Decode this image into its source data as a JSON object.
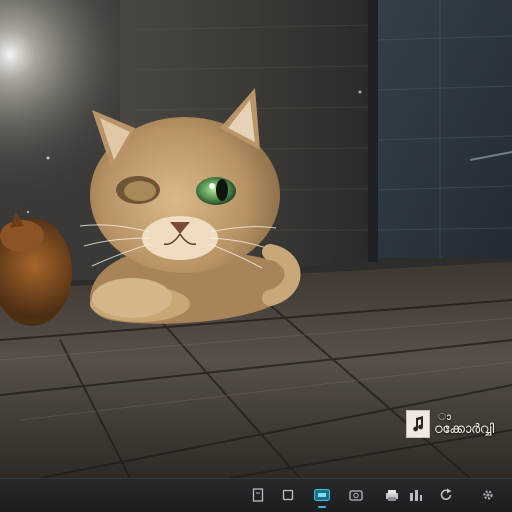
{
  "desktop": {
    "wallpaper": "cat-scene-wallpaper",
    "accent_color": "#34b7d6"
  },
  "notification": {
    "icon": "music-note-icon",
    "line1": "ാ",
    "line2": "ഠക്കോർവ്വി"
  },
  "taskbar": {
    "items": [
      {
        "icon": "document-icon"
      },
      {
        "icon": "window-icon"
      },
      {
        "icon": "app-icon-active",
        "active": true
      },
      {
        "icon": "camera-icon"
      },
      {
        "icon": "printer-icon"
      },
      {
        "icon": "bars-icon"
      },
      {
        "icon": "refresh-icon"
      },
      {
        "icon": "gear-icon"
      }
    ]
  }
}
